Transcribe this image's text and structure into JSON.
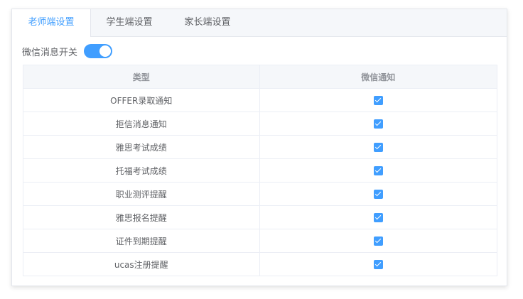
{
  "tabs": [
    "老师端设置",
    "学生端设置",
    "家长端设置"
  ],
  "active_tab": "老师端设置",
  "wechat_switch": {
    "label": "微信消息开关",
    "on": true
  },
  "table": {
    "headers": [
      "类型",
      "微信通知"
    ],
    "rows": [
      {
        "type": "OFFER录取通知",
        "checked": true
      },
      {
        "type": "拒信消息通知",
        "checked": true
      },
      {
        "type": "雅思考试成绩",
        "checked": true
      },
      {
        "type": "托福考试成绩",
        "checked": true
      },
      {
        "type": "职业测评提醒",
        "checked": true
      },
      {
        "type": "雅思报名提醒",
        "checked": true
      },
      {
        "type": "证件到期提醒",
        "checked": true
      },
      {
        "type": "ucas注册提醒",
        "checked": true
      }
    ]
  },
  "colors": {
    "accent": "#409eff",
    "border": "#ebeef5",
    "header_bg": "#f5f7fa"
  }
}
